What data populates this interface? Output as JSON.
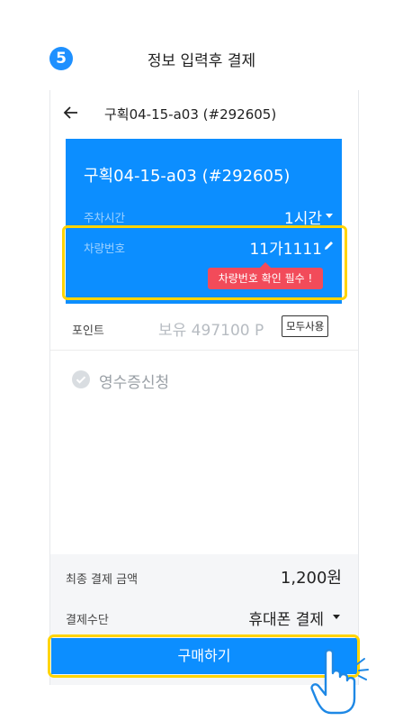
{
  "step": {
    "number": "5",
    "title": "정보 입력후 결제"
  },
  "header": {
    "title": "구획04-15-a03 (#292605)"
  },
  "ticket": {
    "lot_name": "구획04-15-a03 (#292605)",
    "parking_time_label": "주차시간",
    "parking_time_value": "1시간",
    "plate_label": "차량번호",
    "plate_value": "11가1111",
    "plate_warning": "차량번호 확인 필수 !"
  },
  "points": {
    "label": "포인트",
    "balance": "보유 497100 P",
    "use_all_label": "모두사용"
  },
  "receipt": {
    "label": "영수증신청"
  },
  "summary": {
    "total_label": "최종 결제 금액",
    "total_value": "1,200원",
    "payment_method_label": "결제수단",
    "payment_method_value": "휴대폰 결제"
  },
  "buy_button": {
    "label": "구매하기"
  },
  "colors": {
    "accent": "#0c8eff",
    "highlight": "#ffd400",
    "warning": "#f24b5a"
  }
}
